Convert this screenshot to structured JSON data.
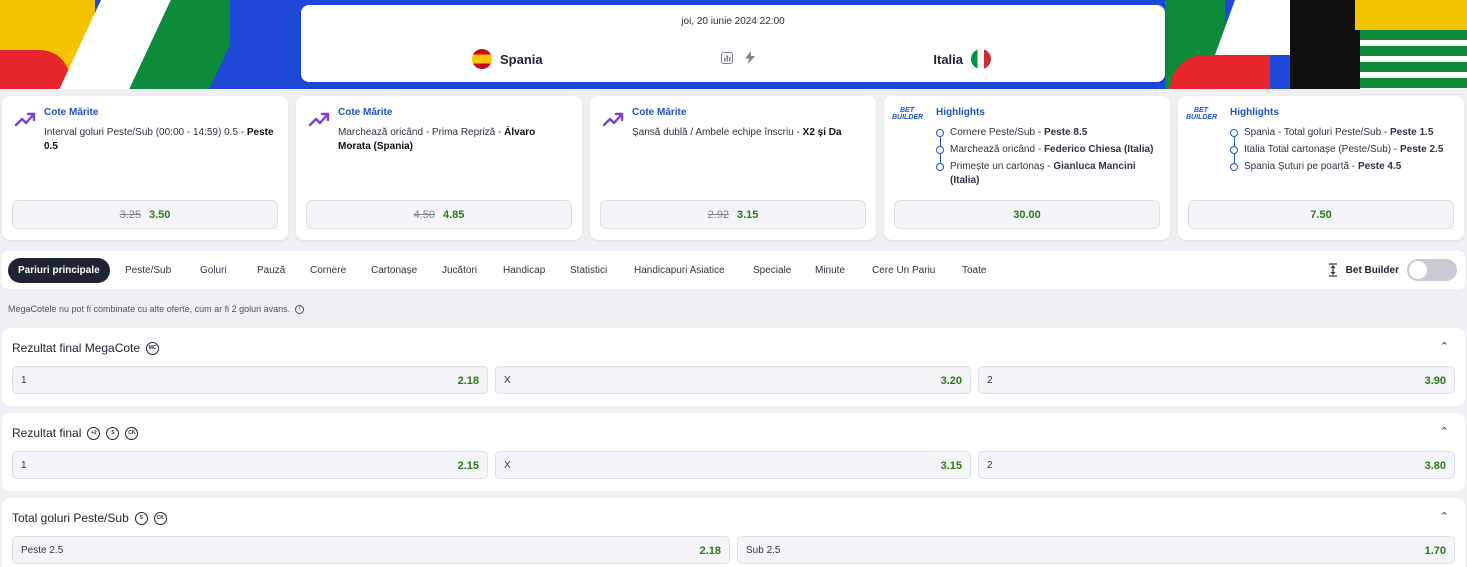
{
  "event": {
    "date": "joi, 20 iunie 2024 22:00",
    "home": "Spania",
    "away": "Italia"
  },
  "promos": [
    {
      "title": "Cote Mărite",
      "desc": "Interval goluri Peste/Sub (00:00 - 14:59) 0.5 - ",
      "desc_bold": "Peste 0.5",
      "old": "3.25",
      "new": "3.50"
    },
    {
      "title": "Cote Mărite",
      "desc": "Marchează oricând - Prima Repriză - ",
      "desc_bold": "Álvaro Morata (Spania)",
      "old": "4.50",
      "new": "4.85"
    },
    {
      "title": "Cote Mărite",
      "desc": "Șansă dublă / Ambele echipe înscriu - ",
      "desc_bold": "X2 și Da",
      "old": "2.92",
      "new": "3.15"
    }
  ],
  "builders": [
    {
      "badge": "BET BUILDER",
      "title": "Highlights",
      "items": [
        {
          "text": "Cornere Peste/Sub - ",
          "bold": "Peste 8.5"
        },
        {
          "text": "Marchează oricând - ",
          "bold": "Federico Chiesa (Italia)"
        },
        {
          "text": "Primește un cartonaș - ",
          "bold": "Gianluca Mancini (Italia)"
        }
      ],
      "odd": "30.00"
    },
    {
      "badge": "BET BUILDER",
      "title": "Highlights",
      "items": [
        {
          "text": "Spania - Total goluri Peste/Sub - ",
          "bold": "Peste 1.5"
        },
        {
          "text": "Italia Total cartonașe (Peste/Sub) - ",
          "bold": "Peste 2.5"
        },
        {
          "text": "Spania Șuturi pe poartă - ",
          "bold": "Peste 4.5"
        }
      ],
      "odd": "7.50"
    }
  ],
  "tabs": [
    "Pariuri principale",
    "Peste/Sub",
    "Goluri",
    "Pauză",
    "Cornere",
    "Cartonașe",
    "Jucători",
    "Handicap",
    "Statistici",
    "Handicapuri Asiatice",
    "Speciale",
    "Minute",
    "Cere Un Pariu",
    "Toate"
  ],
  "bet_builder_label": "Bet Builder",
  "note": "MegaCotele nu pot fi combinate cu alte oferte, cum ar fi 2 goluri avans.",
  "markets": [
    {
      "title": "Rezultat final MegaCote",
      "badges": [
        "MC"
      ],
      "selections": [
        {
          "label": "1",
          "odd": "2.18"
        },
        {
          "label": "X",
          "odd": "3.20"
        },
        {
          "label": "2",
          "odd": "3.90"
        }
      ]
    },
    {
      "title": "Rezultat final",
      "badges": [
        "+2",
        "S",
        "CK"
      ],
      "selections": [
        {
          "label": "1",
          "odd": "2.15"
        },
        {
          "label": "X",
          "odd": "3.15"
        },
        {
          "label": "2",
          "odd": "3.80"
        }
      ]
    },
    {
      "title": "Total goluri Peste/Sub",
      "badges": [
        "S",
        "CK"
      ],
      "selections": [
        {
          "label": "Peste 2.5",
          "odd": "2.18"
        },
        {
          "label": "Sub 2.5",
          "odd": "1.70"
        }
      ]
    }
  ],
  "colors": {
    "accent": "#1f54c6",
    "odd_green": "#2b7a12",
    "active_tab": "#1e2532"
  }
}
